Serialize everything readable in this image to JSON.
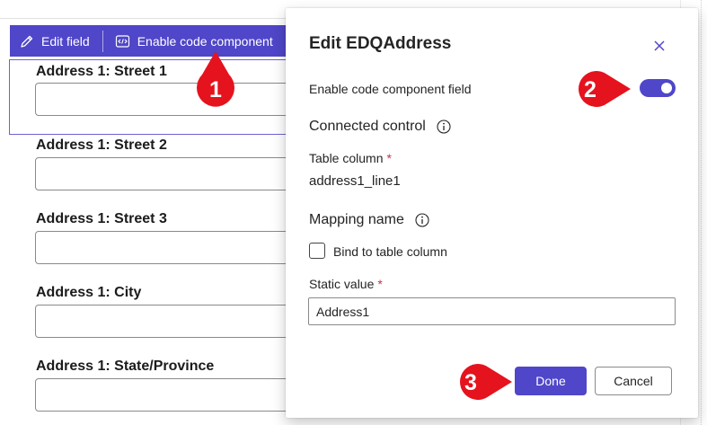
{
  "toolbar": {
    "edit_field_label": "Edit field",
    "enable_code_component_label": "Enable code component"
  },
  "form": {
    "fields": [
      {
        "label": "Address 1: Street 1",
        "value": ""
      },
      {
        "label": "Address 1: Street 2",
        "value": ""
      },
      {
        "label": "Address 1: Street 3",
        "value": ""
      },
      {
        "label": "Address 1: City",
        "value": ""
      },
      {
        "label": "Address 1: State/Province",
        "value": ""
      }
    ]
  },
  "panel": {
    "title": "Edit EDQAddress",
    "enable_code_component_field_label": "Enable code component field",
    "enable_code_component_field_on": true,
    "connected_control_heading": "Connected control",
    "table_column_label": "Table column",
    "table_column_required": "*",
    "table_column_value": "address1_line1",
    "mapping_name_heading": "Mapping name",
    "bind_to_table_column_label": "Bind to table column",
    "bind_to_table_column_checked": false,
    "static_value_label": "Static value",
    "static_value_required": "*",
    "static_value": "Address1",
    "done_label": "Done",
    "cancel_label": "Cancel"
  },
  "callouts": [
    "1",
    "2",
    "3"
  ],
  "colors": {
    "accent": "#4f46c9",
    "callout_red": "#e5131d",
    "required_star": "#c4314b"
  }
}
